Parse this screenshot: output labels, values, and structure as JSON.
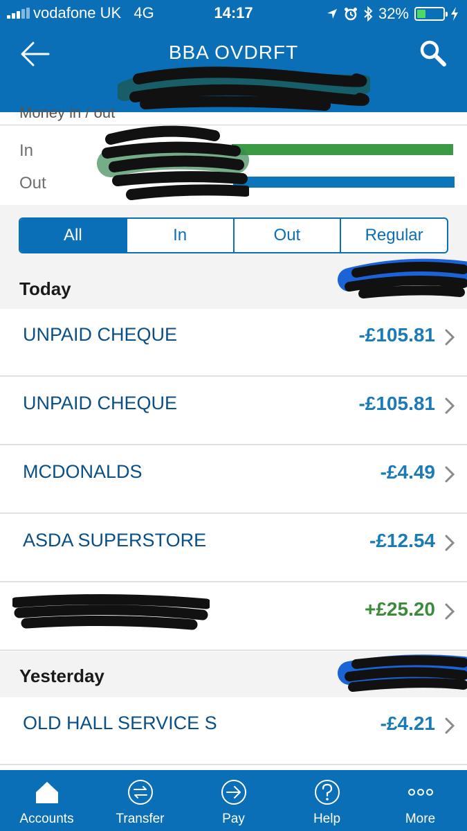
{
  "status_bar": {
    "carrier": "vodafone UK",
    "network": "4G",
    "time": "14:17",
    "battery_percent": "32%",
    "battery_level": 0.32
  },
  "header": {
    "title": "BBA OVDRFT"
  },
  "summary": {
    "heading": "Money in / out",
    "in_label": "In",
    "out_label": "Out",
    "in_bar_fraction": 0.97,
    "out_bar_fraction": 0.97,
    "colors": {
      "in": "#3b9b45",
      "out": "#0b76ba"
    }
  },
  "filters": {
    "options": [
      "All",
      "In",
      "Out",
      "Regular"
    ],
    "selected": "All"
  },
  "sections": [
    {
      "label": "Today",
      "transactions": [
        {
          "name": "UNPAID CHEQUE",
          "amount": "-£105.81",
          "type": "debit"
        },
        {
          "name": "UNPAID CHEQUE",
          "amount": "-£105.81",
          "type": "debit"
        },
        {
          "name": "MCDONALDS",
          "amount": "-£4.49",
          "type": "debit"
        },
        {
          "name": "ASDA SUPERSTORE",
          "amount": "-£12.54",
          "type": "debit"
        },
        {
          "name": "",
          "amount": "+£25.20",
          "type": "credit"
        }
      ]
    },
    {
      "label": "Yesterday",
      "transactions": [
        {
          "name": "OLD HALL SERVICE S",
          "amount": "-£4.21",
          "type": "debit"
        }
      ]
    }
  ],
  "tab_bar": {
    "items": [
      {
        "label": "Accounts",
        "icon": "home-icon"
      },
      {
        "label": "Transfer",
        "icon": "transfer-icon"
      },
      {
        "label": "Pay",
        "icon": "pay-icon"
      },
      {
        "label": "Help",
        "icon": "help-icon"
      },
      {
        "label": "More",
        "icon": "more-icon"
      }
    ]
  },
  "colors": {
    "brand_blue": "#0a6fb7",
    "credit_green": "#3b8b3b",
    "debit_blue": "#1a7bb8"
  }
}
